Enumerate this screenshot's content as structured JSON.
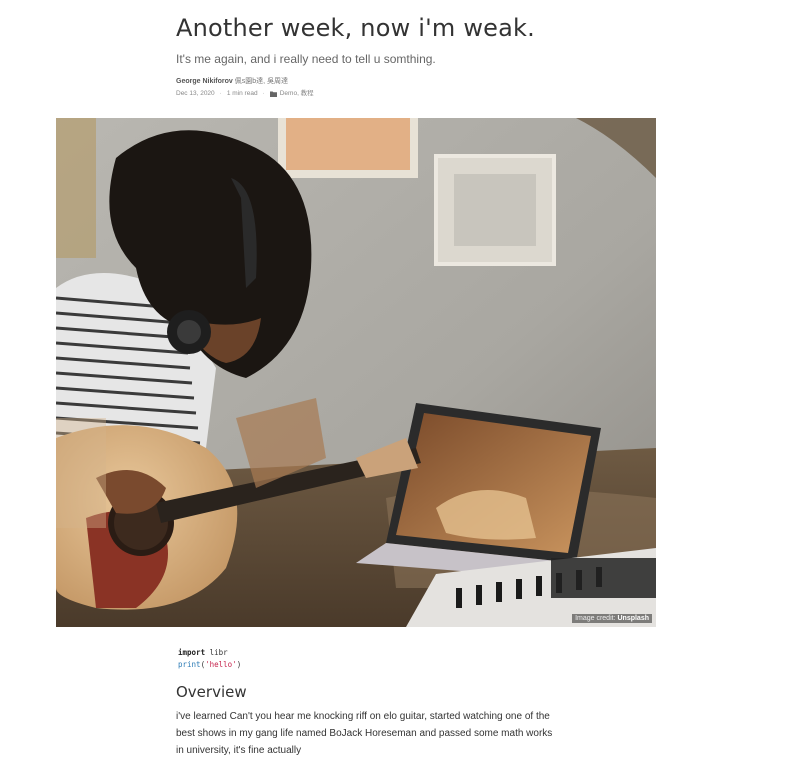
{
  "post": {
    "title": "Another week, now i'm weak.",
    "subtitle": "It's me again, and i really need to tell u somthing.",
    "author": "George Nikiforov",
    "author_alt": "佩s園b達, 吳周達",
    "date": "Dec 13, 2020",
    "read_time": "1 min read",
    "categories": "Demo, 教程"
  },
  "hero": {
    "credit_prefix": "Image credit:",
    "credit_source": "Unsplash"
  },
  "code": {
    "line1_kw": "import",
    "line1_rest": " libr",
    "line2_fn": "print",
    "line2_open": "(",
    "line2_str": "'hello'",
    "line2_close": ")"
  },
  "overview": {
    "heading": "Overview",
    "text": "i've learned Can't you hear me knocking riff on elo guitar, started watching one of the best shows in my gang life named BoJack Horeseman and passed some math works in university, it's fine actually"
  },
  "colors": {
    "title": "#333333",
    "link_code": "#2a7ab5",
    "string_code": "#c7254e"
  }
}
